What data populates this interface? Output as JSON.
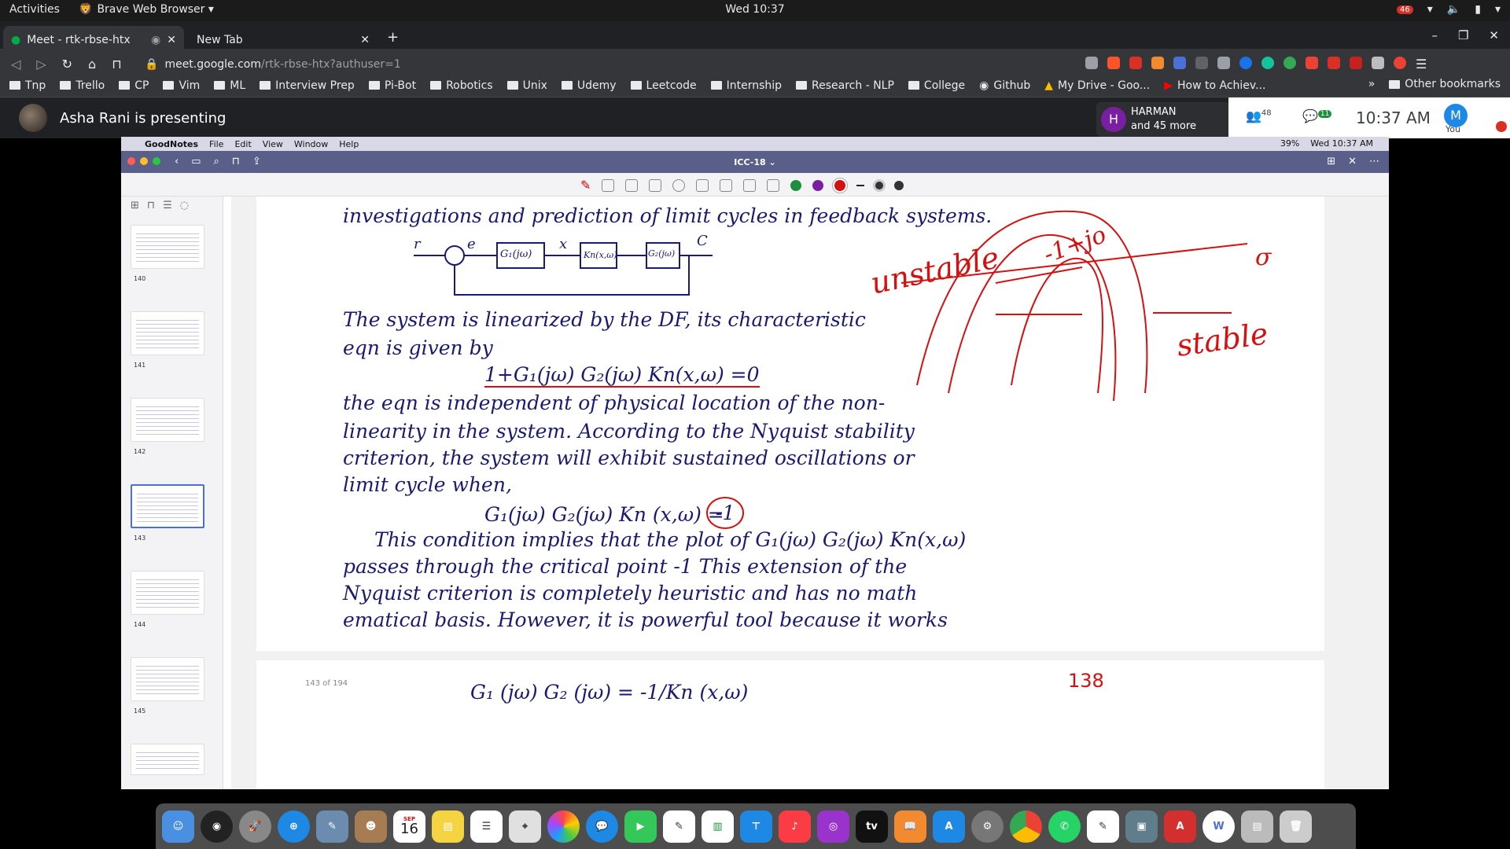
{
  "gnome": {
    "activities": "Activities",
    "app": "Brave Web Browser ▾",
    "clock": "Wed 10:37",
    "badge": "46"
  },
  "tabs": [
    {
      "label": "Meet - rtk-rbse-htx"
    },
    {
      "label": "New Tab"
    }
  ],
  "address": {
    "host": "meet.google.com",
    "path": "/rtk-rbse-htx?authuser=1"
  },
  "bookmarks": [
    "Tnp",
    "Trello",
    "CP",
    "Vim",
    "ML",
    "Interview Prep",
    "Pi-Bot",
    "Robotics",
    "Unix",
    "Udemy",
    "Leetcode",
    "Internship",
    "Research - NLP",
    "College",
    "Github",
    "My Drive - Goo...",
    "How to Achiev..."
  ],
  "bookmarks_more": "»",
  "other_bookmarks": "Other bookmarks",
  "meet": {
    "presenting": "Asha Rani is presenting",
    "harman_initial": "H",
    "harman_name": "HARMAN",
    "harman_more": "and 45 more",
    "people_count": "48",
    "chat_count": "11",
    "time": "10:37 AM",
    "you_initial": "M",
    "you_label": "You"
  },
  "mac": {
    "app": "GoodNotes",
    "menus": [
      "File",
      "Edit",
      "View",
      "Window",
      "Help"
    ],
    "battery": "39%",
    "clock": "Wed 10:37 AM"
  },
  "goodnotes": {
    "title": "ICC-18 ⌄",
    "page_count": "143 of 194",
    "thumbs": [
      "140",
      "141",
      "142",
      "143",
      "144",
      "145"
    ]
  },
  "notes": {
    "l1": "investigations and prediction of limit cycles in feedback systems.",
    "block_r": "r",
    "block_e": "e",
    "block_x": "x",
    "block_c": "C",
    "g1": "G₁(jω)",
    "kn": "Kn(x,ω)",
    "g2": "G₂(jω)",
    "l2": "The system is linearized by the DF, its characteristic",
    "l3": "eqn is given by",
    "l4": "1+G₁(jω) G₂(jω) Kn(x,ω) =0",
    "l5": "the eqn is independent of physical location of the non-",
    "l6": "linearity in the system. According to the Nyquist stability",
    "l7": "criterion, the system will exhibit sustained oscillations or",
    "l8": "limit cycle when,",
    "l9": "G₁(jω) G₂(jω) Kn (x,ω) =",
    "l9b": "-1",
    "l10": "This condition implies that the plot of G₁(jω) G₂(jω) Kn(x,ω)",
    "l11": "passes through the critical point -1 This extension of the",
    "l12": "Nyquist criterion is completely heuristic and has no math",
    "l13": "ematical basis. However, it is powerful tool because it works",
    "l14": "G₁ (jω) G₂ (jω) = -1/Kn (x,ω)",
    "page_num": "138",
    "red_unstable": "unstable",
    "red_stable": "stable",
    "red_jo": "-1+jo",
    "red_sigma": "σ"
  },
  "dock_calendar": "16",
  "dock_calendar_month": "SEP"
}
